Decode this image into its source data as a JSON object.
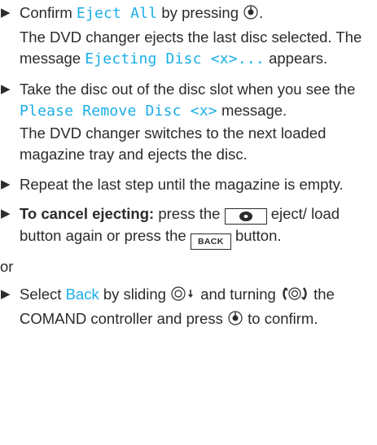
{
  "steps": [
    {
      "pre": "Confirm ",
      "ui": "Eject All",
      "post": " by pressing ",
      "end": ".",
      "desc_1": "The DVD changer ejects the last disc selected. The message ",
      "desc_ui": "Ejecting Disc <x>...",
      "desc_2": " appears."
    },
    {
      "pre": "Take the disc out of the disc slot when you see the ",
      "ui": "Please Remove Disc <x>",
      "post": " message.",
      "desc": "The DVD changer switches to the next loaded magazine tray and ejects the disc."
    },
    {
      "text": "Repeat the last step until the magazine is empty."
    },
    {
      "bold": "To cancel ejecting:",
      "pre": " press the ",
      "mid": " eject/ load button again or press the ",
      "back_key": "BACK",
      "post": " button."
    }
  ],
  "or_text": "or",
  "last_step": {
    "pre": "Select ",
    "ui": "Back",
    "mid1": " by sliding ",
    "mid2": " and turning ",
    "mid3": " the COMAND controller and press ",
    "post": " to confirm."
  },
  "icons": {
    "bullet": "triangle-bullet-icon",
    "press": "press-controller-icon",
    "slide": "slide-down-controller-icon",
    "turn": "turn-controller-icon",
    "eject": "eject-button-icon"
  },
  "colors": {
    "ui_text": "#1aaee8",
    "body_text": "#2b2b2b"
  }
}
